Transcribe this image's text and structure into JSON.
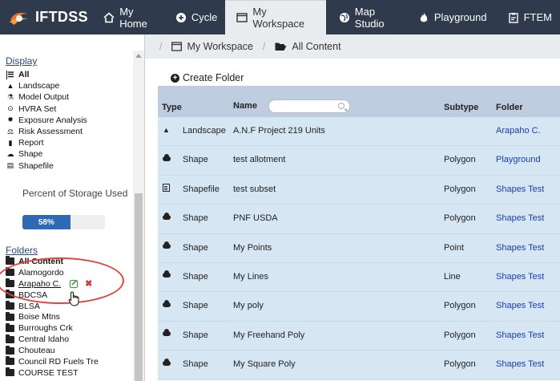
{
  "nav": {
    "brand": "IFTDSS",
    "items": [
      {
        "label": "My Home",
        "icon": "home-icon"
      },
      {
        "label": "Cycle",
        "icon": "cycle-icon"
      },
      {
        "label": "My Workspace",
        "icon": "window-icon",
        "active": true
      },
      {
        "label": "Map Studio",
        "icon": "globe-icon"
      },
      {
        "label": "Playground",
        "icon": "fire-icon"
      },
      {
        "label": "FTEM",
        "icon": "clipboard-icon"
      }
    ]
  },
  "sidebar": {
    "display_title": "Display",
    "display_items": [
      {
        "label": "All",
        "icon": "list-icon",
        "bold": true
      },
      {
        "label": "Landscape",
        "icon": "tree-icon"
      },
      {
        "label": "Model Output",
        "icon": "flask-icon"
      },
      {
        "label": "HVRA Set",
        "icon": "map-marker-icon"
      },
      {
        "label": "Exposure Analysis",
        "icon": "gear-icon"
      },
      {
        "label": "Risk Assessment",
        "icon": "balance-icon"
      },
      {
        "label": "Report",
        "icon": "bar-chart-icon"
      },
      {
        "label": "Shape",
        "icon": "cloud-icon"
      },
      {
        "label": "Shapefile",
        "icon": "file-icon"
      }
    ],
    "storage_label": "Percent of Storage Used",
    "storage_percent": 58,
    "storage_text": "58%",
    "folders_title": "Folders",
    "folders": [
      {
        "label": "All Content",
        "bold": true
      },
      {
        "label": "Alamogordo"
      },
      {
        "label": "Arapaho C.",
        "underline": true,
        "actions": true
      },
      {
        "label": "BDCSA"
      },
      {
        "label": "BLSA"
      },
      {
        "label": "Boise Mtns"
      },
      {
        "label": "Burroughs Crk"
      },
      {
        "label": "Central Idaho"
      },
      {
        "label": "Chouteau"
      },
      {
        "label": "Council RD Fuels Tre"
      },
      {
        "label": "COURSE TEST"
      }
    ]
  },
  "breadcrumb": {
    "items": [
      "My Workspace",
      "All Content"
    ]
  },
  "toolbar": {
    "create_folder": "Create Folder"
  },
  "table": {
    "headers": {
      "type": "Type",
      "name": "Name",
      "subtype": "Subtype",
      "folder": "Folder"
    },
    "rows": [
      {
        "icon": "tree-icon",
        "type": "Landscape",
        "name": "A.N.F Project 219 Units",
        "subtype": "",
        "folder": "Arapaho C."
      },
      {
        "icon": "cloud-icon",
        "type": "Shape",
        "name": "test allotment",
        "subtype": "Polygon",
        "folder": "Playground"
      },
      {
        "icon": "file-icon",
        "type": "Shapefile",
        "name": "test subset",
        "subtype": "Polygon",
        "folder": "Shapes Test"
      },
      {
        "icon": "cloud-icon",
        "type": "Shape",
        "name": "PNF USDA",
        "subtype": "Polygon",
        "folder": "Shapes Test"
      },
      {
        "icon": "cloud-icon",
        "type": "Shape",
        "name": "My Points",
        "subtype": "Point",
        "folder": "Shapes Test"
      },
      {
        "icon": "cloud-icon",
        "type": "Shape",
        "name": "My Lines",
        "subtype": "Line",
        "folder": "Shapes Test"
      },
      {
        "icon": "cloud-icon",
        "type": "Shape",
        "name": "My poly",
        "subtype": "Polygon",
        "folder": "Shapes Test"
      },
      {
        "icon": "cloud-icon",
        "type": "Shape",
        "name": "My Freehand Poly",
        "subtype": "Polygon",
        "folder": "Shapes Test"
      },
      {
        "icon": "cloud-icon",
        "type": "Shape",
        "name": "My Square Poly",
        "subtype": "Polygon",
        "folder": "Shapes Test"
      }
    ]
  },
  "colors": {
    "nav_bg": "#2f3b4c",
    "table_header": "#bfcde0",
    "row_bg": "#d6e6f3",
    "link": "#1a3db3",
    "highlight_ellipse": "#e0453b",
    "storage_fill": "#2d6ab3"
  }
}
